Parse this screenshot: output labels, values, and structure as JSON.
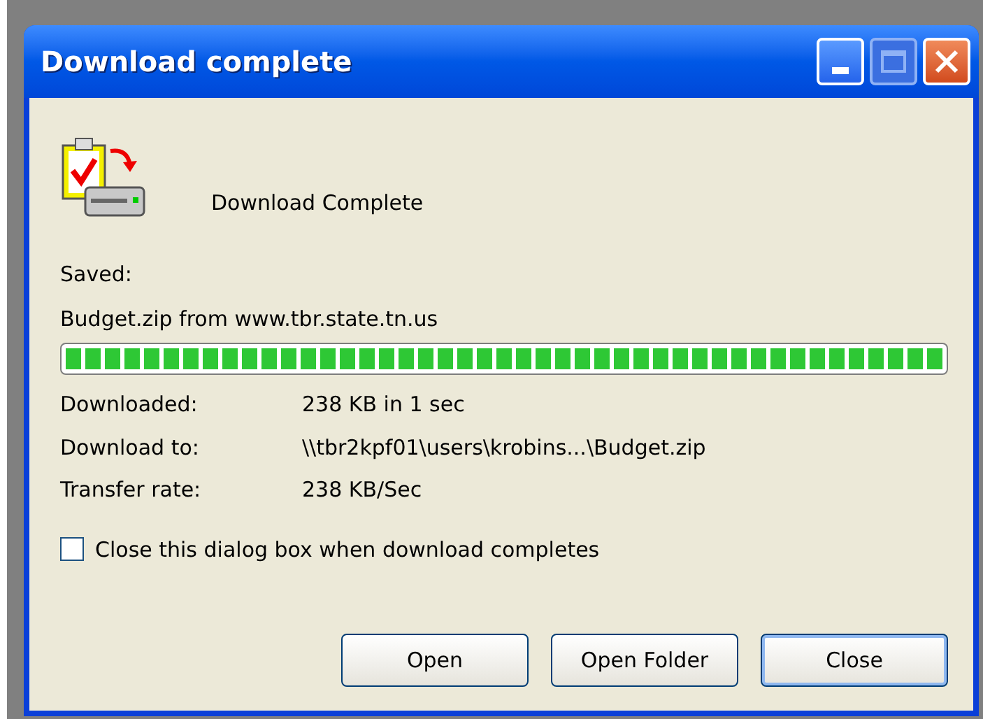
{
  "window": {
    "title": "Download complete"
  },
  "header": {
    "message": "Download Complete"
  },
  "saved_label": "Saved:",
  "saved_file": "Budget.zip from www.tbr.state.tn.us",
  "progress": {
    "level": 1
  },
  "details": [
    {
      "label": "Downloaded:",
      "value": "238 KB in 1 sec"
    },
    {
      "label": "Download to:",
      "value": "\\\\tbr2kpf01\\users\\krobins...\\Budget.zip"
    },
    {
      "label": "Transfer rate:",
      "value": "238 KB/Sec"
    }
  ],
  "close_when_done": {
    "label": "Close this dialog box when download completes",
    "checked": false
  },
  "buttons": [
    {
      "label": "Open",
      "default": false
    },
    {
      "label": "Open Folder",
      "default": false
    },
    {
      "label": "Close",
      "default": true
    }
  ]
}
